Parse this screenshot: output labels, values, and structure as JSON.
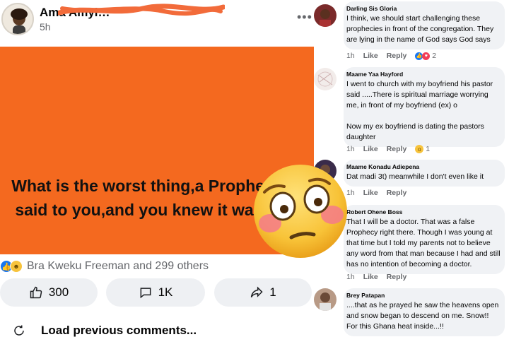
{
  "post": {
    "author": "Ama Amyi…",
    "time": "5h",
    "more_icon": "more-horizontal-icon",
    "banner": {
      "line1": "What is the worst thing,a Prophet has",
      "line2": "said to you,and you knew it was a lie",
      "background_color": "#f4691f"
    },
    "reactions": {
      "icons": [
        "like-icon",
        "haha-icon"
      ],
      "summary": "Bra Kweku Freeman and 299 others"
    },
    "actions": {
      "like_count": "300",
      "comment_count": "1K",
      "share_count": "1"
    },
    "load_previous": "Load previous comments..."
  },
  "comments": [
    {
      "name": "Darling Sis Gloria",
      "text": "I think, we should start challenging these prophecies in front of the congregation. They are lying in the name of God says God says",
      "time": "1h",
      "like": "Like",
      "reply": "Reply",
      "reaction_icons": [
        "like-icon",
        "love-icon"
      ],
      "reaction_count": "2"
    },
    {
      "name": "Maame Yaa Hayford",
      "text": "I went to church with my boyfriend his pastor said .....There is spiritual marriage worrying me, in front of my boyfriend (ex) o\n\nNow my ex boyfriend is dating the pastors daughter",
      "time": "1h",
      "like": "Like",
      "reply": "Reply",
      "reaction_icons": [
        "wow-icon"
      ],
      "reaction_count": "1"
    },
    {
      "name": "Maame Konadu Adiepena",
      "text": "Dat madi 3t) meanwhile I don't even like it",
      "time": "1h",
      "like": "Like",
      "reply": "Reply"
    },
    {
      "name": "Robert Ohene Boss",
      "text": "That I will be a doctor. That was a false Prophecy right there. Though I was young at that time but I told my parents not to believe any word from that man because I had and still has no intention of becoming a doctor.",
      "time": "1h",
      "like": "Like",
      "reply": "Reply"
    },
    {
      "name": "Brey Patapan",
      "text": "....that as he prayed he saw the heavens open and snow began to descend on me. Snow!! For this Ghana heat inside...!!"
    }
  ],
  "overlay": {
    "emoji": "flushed-face-emoji"
  },
  "colors": {
    "accent": "#1877f2",
    "muted": "#65676b",
    "bubble": "#f0f2f5"
  }
}
